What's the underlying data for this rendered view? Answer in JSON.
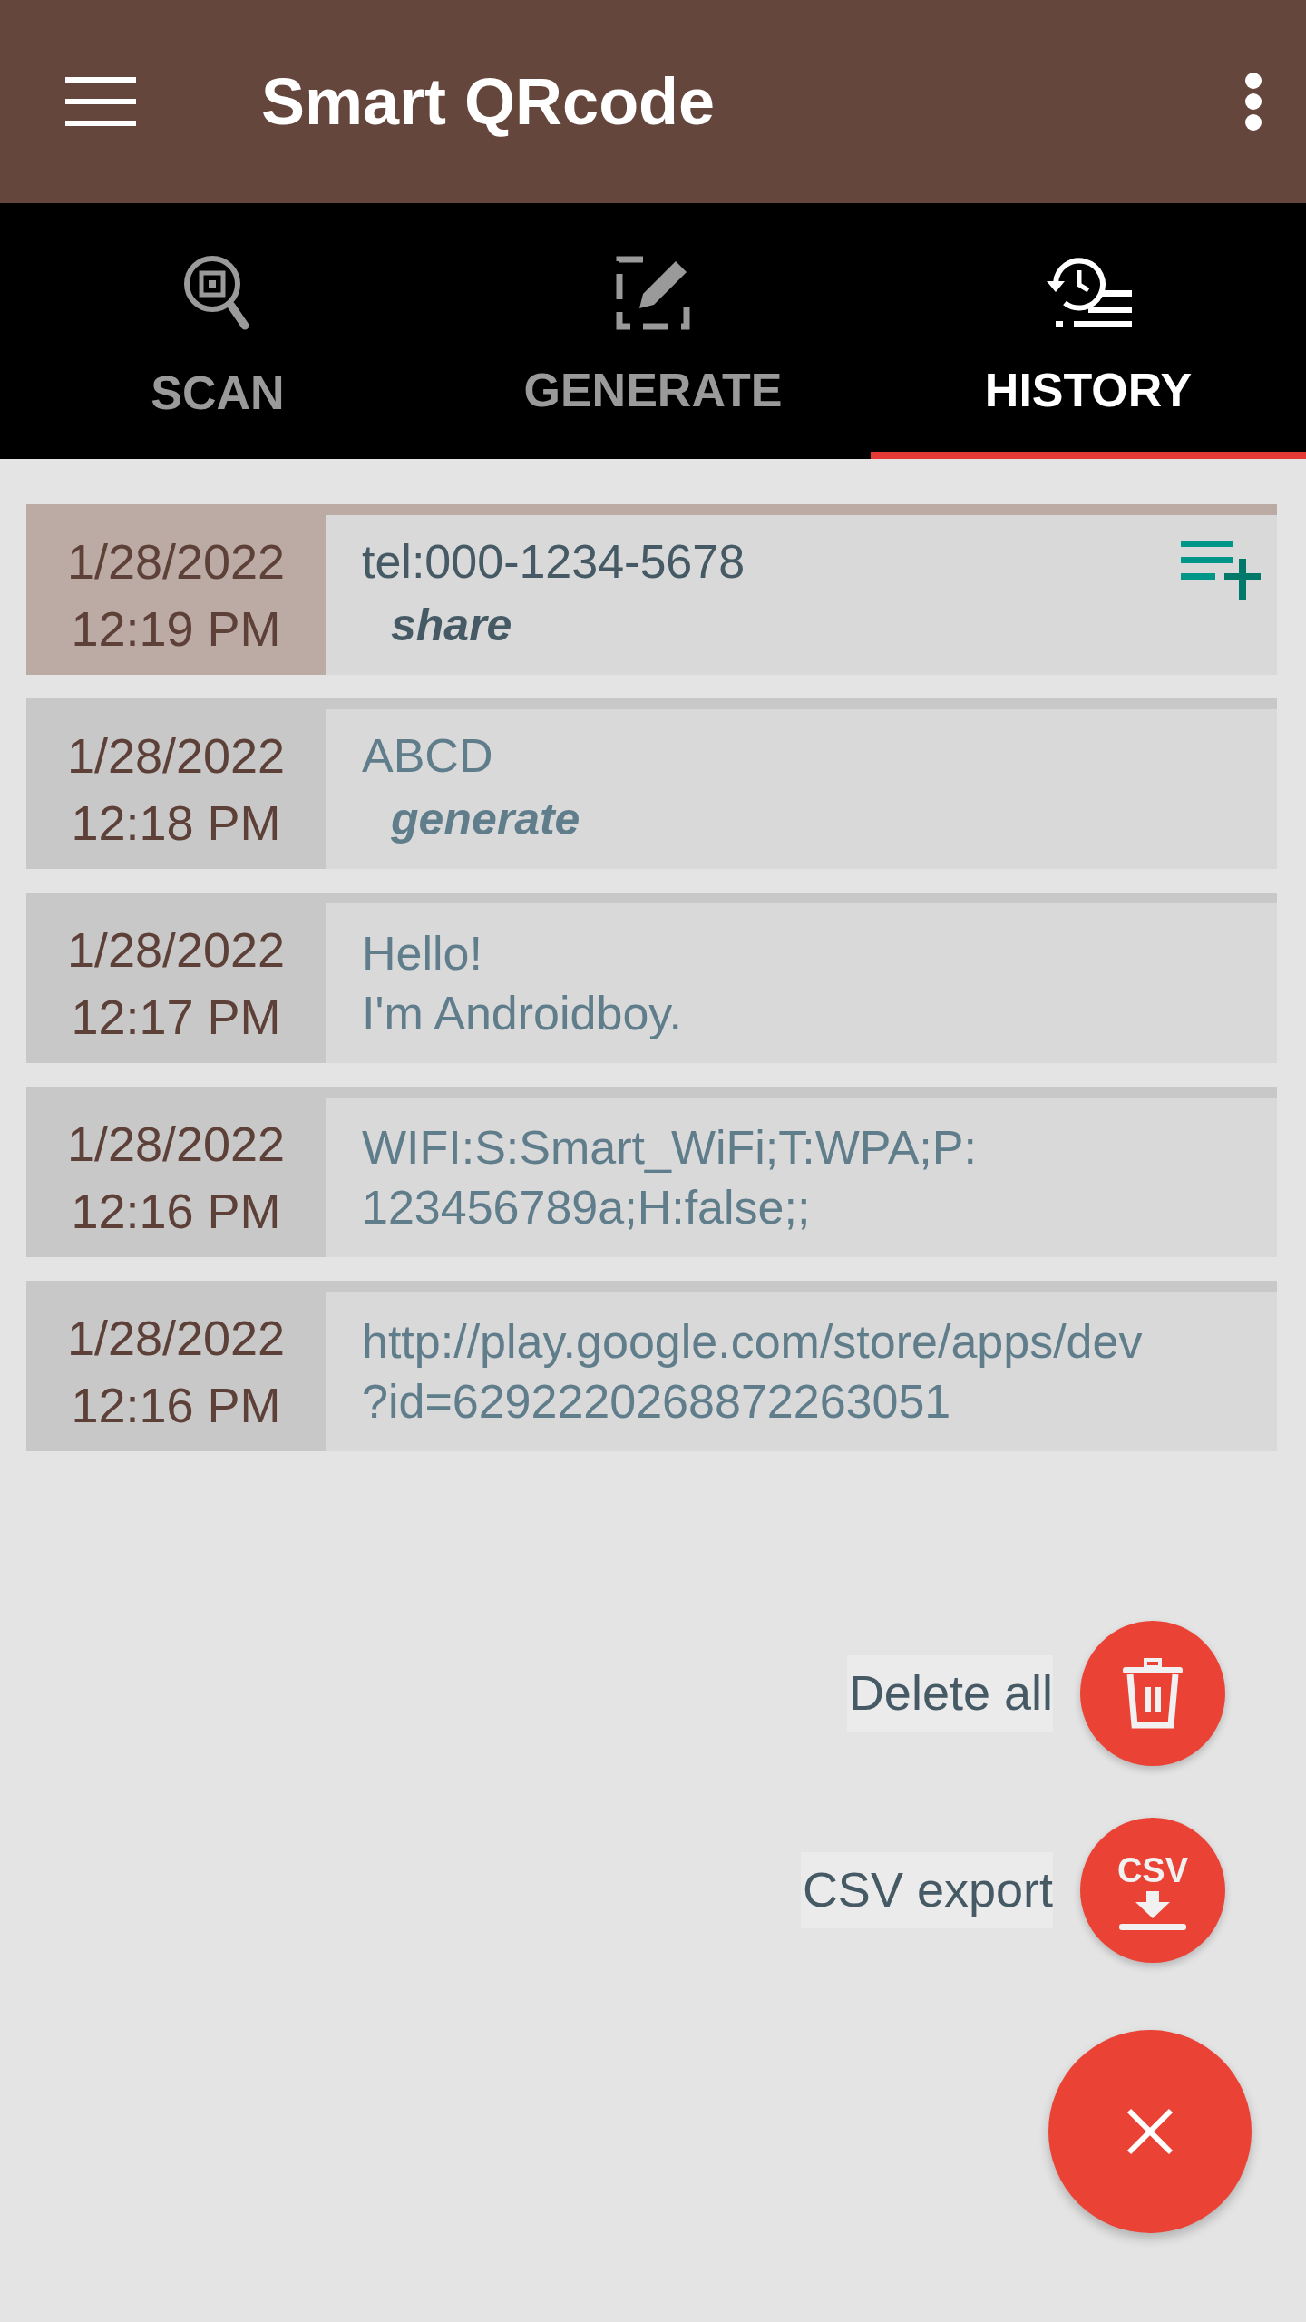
{
  "app_bar": {
    "title": "Smart QRcode"
  },
  "tabs": [
    {
      "label": "SCAN",
      "kind": "scan",
      "selected": false
    },
    {
      "label": "GENERATE",
      "kind": "generate",
      "selected": false
    },
    {
      "label": "HISTORY",
      "kind": "history",
      "selected": true
    }
  ],
  "history": [
    {
      "date": "1/28/2022",
      "time": "12:19 PM",
      "text": "tel:000-1234-5678",
      "action": "share",
      "selected": true
    },
    {
      "date": "1/28/2022",
      "time": "12:18 PM",
      "text": "ABCD",
      "action": "generate",
      "selected": false
    },
    {
      "date": "1/28/2022",
      "time": "12:17 PM",
      "text": "Hello!\nI'm Androidboy.",
      "selected": false
    },
    {
      "date": "1/28/2022",
      "time": "12:16 PM",
      "text": "WIFI:S:Smart_WiFi;T:WPA;P:\n123456789a;H:false;;",
      "selected": false
    },
    {
      "date": "1/28/2022",
      "time": "12:16 PM",
      "text": "http://play.google.com/store/apps/dev\n?id=6292220268872263051",
      "selected": false
    }
  ],
  "fab_menu": [
    {
      "label": "Delete all",
      "kind": "delete"
    },
    {
      "label": "CSV export",
      "kind": "csv",
      "icon_text": "CSV"
    }
  ]
}
